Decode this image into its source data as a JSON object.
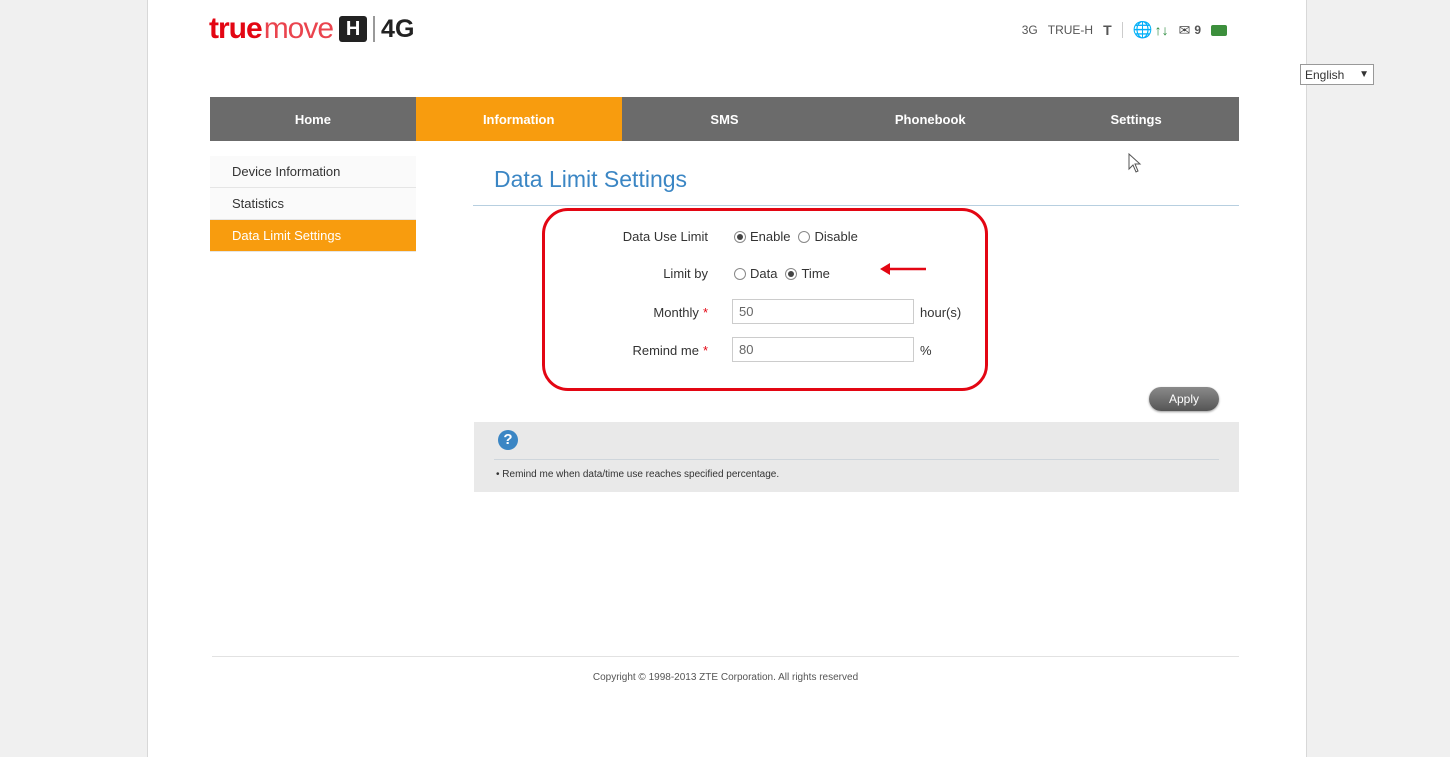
{
  "brand": {
    "true": "true",
    "move": "move",
    "h": "H",
    "network": "4G"
  },
  "status": {
    "network_type": "3G",
    "operator": "TRUE-H",
    "signal": "T",
    "messages_count": "9"
  },
  "language": {
    "selected": "English"
  },
  "nav": {
    "items": [
      {
        "label": "Home",
        "active": false
      },
      {
        "label": "Information",
        "active": true
      },
      {
        "label": "SMS",
        "active": false
      },
      {
        "label": "Phonebook",
        "active": false
      },
      {
        "label": "Settings",
        "active": false
      }
    ]
  },
  "sidebar": {
    "items": [
      {
        "label": "Device Information",
        "active": false
      },
      {
        "label": "Statistics",
        "active": false
      },
      {
        "label": "Data Limit Settings",
        "active": true
      }
    ]
  },
  "page": {
    "title": "Data Limit Settings"
  },
  "form": {
    "data_use_limit": {
      "label": "Data Use Limit",
      "options": [
        "Enable",
        "Disable"
      ],
      "selected": "Enable"
    },
    "limit_by": {
      "label": "Limit by",
      "options": [
        "Data",
        "Time"
      ],
      "selected": "Time"
    },
    "monthly": {
      "label": "Monthly",
      "required": "*",
      "value": "50",
      "unit": "hour(s)"
    },
    "remind_me": {
      "label": "Remind me",
      "required": "*",
      "value": "80",
      "unit": "%"
    },
    "apply_label": "Apply"
  },
  "help": {
    "icon": "?",
    "text": "• Remind me when data/time use reaches specified percentage."
  },
  "footer": {
    "copyright": "Copyright © 1998-2013 ZTE Corporation. All rights reserved"
  },
  "colors": {
    "accent": "#f89c0e",
    "nav": "#6b6b6b",
    "title": "#3b86c4",
    "highlight": "#e30613"
  }
}
